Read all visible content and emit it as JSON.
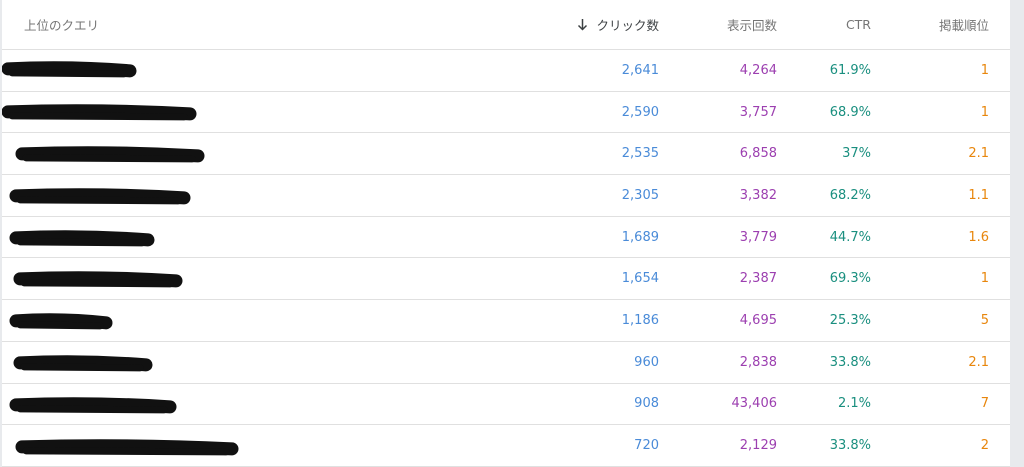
{
  "table": {
    "headers": {
      "query": "上位のクエリ",
      "clicks": "クリック数",
      "impressions": "表示回数",
      "ctr": "CTR",
      "position": "掲載順位"
    },
    "rows": [
      {
        "clicks": "2,641",
        "impressions": "4,264",
        "ctr": "61.9%",
        "position": "1"
      },
      {
        "clicks": "2,590",
        "impressions": "3,757",
        "ctr": "68.9%",
        "position": "1"
      },
      {
        "clicks": "2,535",
        "impressions": "6,858",
        "ctr": "37%",
        "position": "2.1"
      },
      {
        "clicks": "2,305",
        "impressions": "3,382",
        "ctr": "68.2%",
        "position": "1.1"
      },
      {
        "clicks": "1,689",
        "impressions": "3,779",
        "ctr": "44.7%",
        "position": "1.6"
      },
      {
        "clicks": "1,654",
        "impressions": "2,387",
        "ctr": "69.3%",
        "position": "1"
      },
      {
        "clicks": "1,186",
        "impressions": "4,695",
        "ctr": "25.3%",
        "position": "5"
      },
      {
        "clicks": "960",
        "impressions": "2,838",
        "ctr": "33.8%",
        "position": "2.1"
      },
      {
        "clicks": "908",
        "impressions": "43,406",
        "ctr": "2.1%",
        "position": "7"
      },
      {
        "clicks": "720",
        "impressions": "2,129",
        "ctr": "33.8%",
        "position": "2"
      }
    ]
  },
  "colors": {
    "clicks": "#4a8bd8",
    "impressions": "#9c3fb0",
    "ctr": "#1a8f7f",
    "position": "#e8860c"
  },
  "icons": {
    "sort": "arrow-down-icon"
  }
}
